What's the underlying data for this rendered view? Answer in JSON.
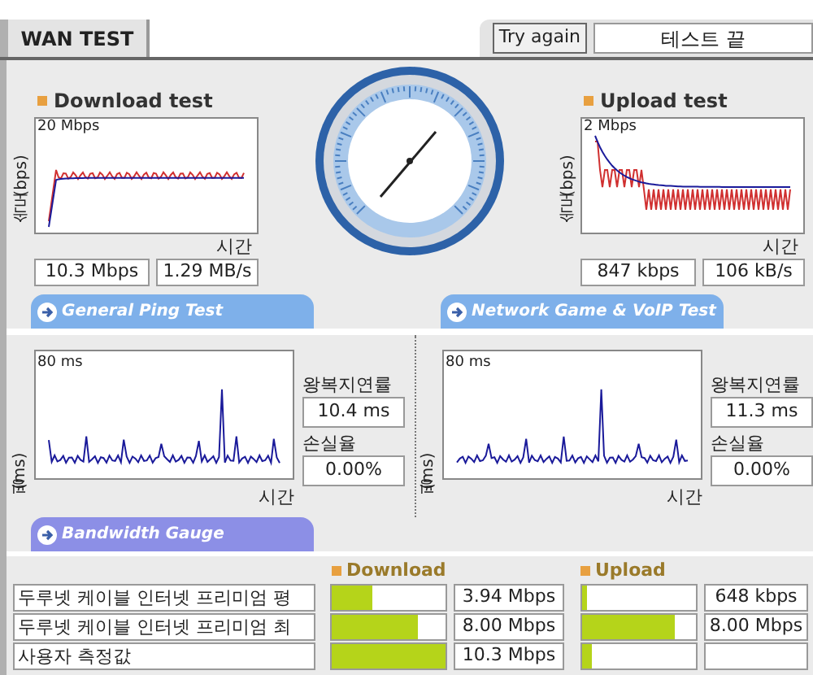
{
  "window": {
    "tab": "WAN TEST"
  },
  "toolbar": {
    "button": "Try again",
    "status": "테스트 끝"
  },
  "download": {
    "title": "Download test",
    "y_label": "속도 (bps)",
    "scale": "20 Mbps",
    "x_label": "시간",
    "rate": "10.3 Mbps",
    "bytes": "1.29 MB/s"
  },
  "upload": {
    "title": "Upload test",
    "y_label": "속도 (bps)",
    "scale": "2 Mbps",
    "x_label": "시간",
    "rate": "847 kbps",
    "bytes": "106 kB/s"
  },
  "sections": [
    {
      "title": "General Ping Test",
      "y_label": "핑(ms)",
      "scale": "80 ms",
      "x_label": "시간",
      "latency_label": "왕복지연률",
      "latency": "10.4 ms",
      "loss_label": "손실율",
      "loss": "0.00%"
    },
    {
      "title": "Network Game & VoIP Test",
      "y_label": "핑(ms)",
      "scale": "80 ms",
      "x_label": "시간",
      "latency_label": "왕복지연률",
      "latency": "11.3 ms",
      "loss_label": "손실율",
      "loss": "0.00%"
    }
  ],
  "bandwidth": {
    "title": "Bandwidth Gauge",
    "download_label": "Download",
    "upload_label": "Upload",
    "rows": [
      {
        "name": "두루넷 케이블 인터넷 프리미엄 평",
        "download": {
          "level": 0.35,
          "reading": "3.94 Mbps"
        },
        "upload": {
          "level": 0.04,
          "reading": "648 kbps"
        }
      },
      {
        "name": "두루넷 케이블 인터넷 프리미엄 최",
        "download": {
          "level": 0.75,
          "reading": "8.00 Mbps"
        },
        "upload": {
          "level": 0.82,
          "reading": "8.00 Mbps"
        }
      },
      {
        "name": "사용자 측정값",
        "download": {
          "level": 1,
          "reading": "10.3 Mbps"
        },
        "upload": {
          "level": 0.08
        }
      }
    ]
  }
}
